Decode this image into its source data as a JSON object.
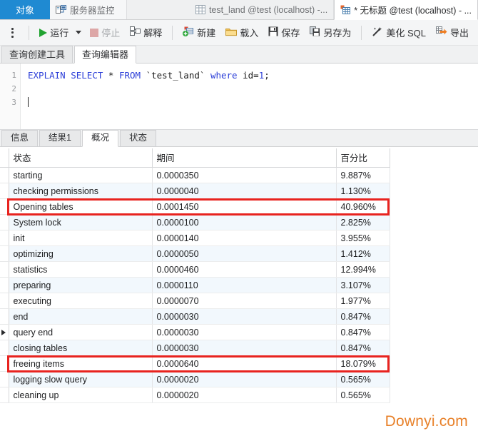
{
  "window_tabs": [
    {
      "label": "对象",
      "icon": "",
      "state": "selected"
    },
    {
      "label": "服务器监控",
      "icon": "monitor-icon",
      "state": "normal"
    }
  ],
  "doc_tabs": [
    {
      "label": "test_land @test (localhost) -...",
      "icon": "grid-icon",
      "state": "inactive"
    },
    {
      "label": "* 无标题 @test (localhost) - ...",
      "icon": "query-icon",
      "state": "active"
    }
  ],
  "toolbar": {
    "menu_icon": "hamburger-icon",
    "run_label": "运行",
    "run_icon": "play-icon",
    "run_dropdown_icon": "chevron-down-icon",
    "stop_label": "停止",
    "stop_icon": "stop-icon",
    "explain_label": "解释",
    "explain_icon": "explain-icon",
    "new_label": "新建",
    "new_icon": "new-query-icon",
    "load_label": "载入",
    "load_icon": "folder-icon",
    "save_label": "保存",
    "save_icon": "floppy-icon",
    "save_as_label": "另存为",
    "save_as_icon": "save-as-icon",
    "beautify_label": "美化 SQL",
    "beautify_icon": "wand-icon",
    "export_label": "导出",
    "export_icon": "export-icon"
  },
  "editor_tabs": [
    {
      "label": "查询创建工具",
      "state": "inactive"
    },
    {
      "label": "查询编辑器",
      "state": "active"
    }
  ],
  "editor": {
    "line_numbers": [
      "1",
      "2",
      "3"
    ],
    "sql": {
      "kw_explain": "EXPLAIN",
      "kw_select": "SELECT",
      "star": "*",
      "kw_from": "FROM",
      "table": "`test_land`",
      "kw_where": "where",
      "cond_field": "id=",
      "cond_value": "1",
      "semicolon": ";"
    }
  },
  "result_tabs": [
    {
      "label": "信息",
      "state": "inactive"
    },
    {
      "label": "结果1",
      "state": "inactive"
    },
    {
      "label": "概况",
      "state": "active"
    },
    {
      "label": "状态",
      "state": "inactive"
    }
  ],
  "grid": {
    "columns": [
      "状态",
      "期间",
      "百分比"
    ],
    "rows": [
      {
        "status": "starting",
        "duration": "0.0000350",
        "percent": "9.887%",
        "highlight": false,
        "marker": false
      },
      {
        "status": "checking permissions",
        "duration": "0.0000040",
        "percent": "1.130%",
        "highlight": false,
        "marker": false
      },
      {
        "status": "Opening tables",
        "duration": "0.0001450",
        "percent": "40.960%",
        "highlight": true,
        "marker": false
      },
      {
        "status": "System lock",
        "duration": "0.0000100",
        "percent": "2.825%",
        "highlight": false,
        "marker": false
      },
      {
        "status": "init",
        "duration": "0.0000140",
        "percent": "3.955%",
        "highlight": false,
        "marker": false
      },
      {
        "status": "optimizing",
        "duration": "0.0000050",
        "percent": "1.412%",
        "highlight": false,
        "marker": false
      },
      {
        "status": "statistics",
        "duration": "0.0000460",
        "percent": "12.994%",
        "highlight": false,
        "marker": false
      },
      {
        "status": "preparing",
        "duration": "0.0000110",
        "percent": "3.107%",
        "highlight": false,
        "marker": false
      },
      {
        "status": "executing",
        "duration": "0.0000070",
        "percent": "1.977%",
        "highlight": false,
        "marker": false
      },
      {
        "status": "end",
        "duration": "0.0000030",
        "percent": "0.847%",
        "highlight": false,
        "marker": false
      },
      {
        "status": "query end",
        "duration": "0.0000030",
        "percent": "0.847%",
        "highlight": false,
        "marker": true
      },
      {
        "status": "closing tables",
        "duration": "0.0000030",
        "percent": "0.847%",
        "highlight": false,
        "marker": false
      },
      {
        "status": "freeing items",
        "duration": "0.0000640",
        "percent": "18.079%",
        "highlight": true,
        "marker": false
      },
      {
        "status": "logging slow query",
        "duration": "0.0000020",
        "percent": "0.565%",
        "highlight": false,
        "marker": false
      },
      {
        "status": "cleaning up",
        "duration": "0.0000020",
        "percent": "0.565%",
        "highlight": false,
        "marker": false
      }
    ]
  },
  "watermark": {
    "text": "Downyi.com",
    "color": "#e8812a"
  },
  "colors": {
    "accent_blue": "#1f8ad2",
    "highlight_red": "#e8231f",
    "alt_row": "#f2f8fd",
    "keyword_blue": "#2b3ed8",
    "run_green": "#21a331"
  }
}
